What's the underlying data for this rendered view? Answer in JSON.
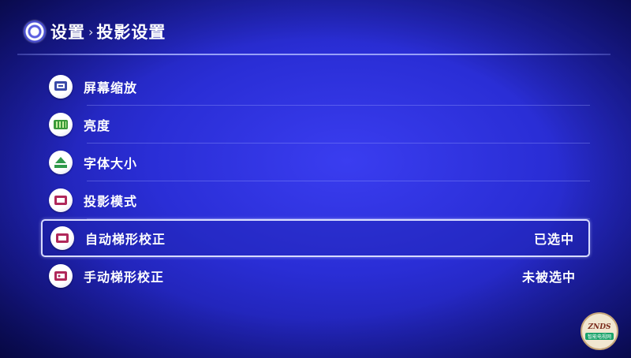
{
  "header": {
    "crumb_root": "设置",
    "crumb_separator": "›",
    "crumb_current": "投影设置"
  },
  "menu": {
    "items": [
      {
        "label": "屏幕缩放",
        "status": "",
        "icon": "screen-zoom-icon",
        "icon_color": "#3a4aa8"
      },
      {
        "label": "亮度",
        "status": "",
        "icon": "brightness-icon",
        "icon_color": "#3a9a3a"
      },
      {
        "label": "字体大小",
        "status": "",
        "icon": "font-size-icon",
        "icon_color": "#2f9a4a"
      },
      {
        "label": "投影模式",
        "status": "",
        "icon": "projection-mode-icon",
        "icon_color": "#b0285a"
      },
      {
        "label": "自动梯形校正",
        "status": "已选中",
        "icon": "auto-keystone-icon",
        "icon_color": "#b0285a",
        "selected": true
      },
      {
        "label": "手动梯形校正",
        "status": "未被选中",
        "icon": "manual-keystone-icon",
        "icon_color": "#b0285a"
      }
    ]
  },
  "watermark": {
    "text": "ZNDS",
    "sub": "智能电视网"
  },
  "colors": {
    "background": "#2a2ed6",
    "selection_border": "#d8dcff",
    "text": "#ffffff"
  }
}
